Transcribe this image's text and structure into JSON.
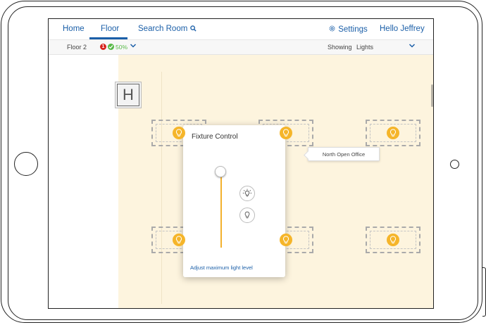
{
  "nav": {
    "home": "Home",
    "floor": "Floor",
    "search_room": "Search Room",
    "settings": "Settings",
    "user": "Hello Jeffrey"
  },
  "subbar": {
    "floor_name": "Floor 2",
    "alert_count": "1",
    "ok_percent": "50%",
    "showing_label": "Showing",
    "showing_value": "Lights"
  },
  "map": {
    "sign_letter": "H",
    "tooltip": "North Open Office"
  },
  "fixture_control": {
    "title": "Fixture Control",
    "adjust_link": "Adjust maximum light level",
    "slider_level": 1.0
  },
  "colors": {
    "accent": "#1b5fa8",
    "bulb": "#f5b52a",
    "plan": "#fdf4de",
    "alert": "#d7241d",
    "ok": "#58b947"
  },
  "icons": [
    "search-icon",
    "gear-icon",
    "chevron-down-icon",
    "lightbulb-icon",
    "bulb-on-icon",
    "bulb-off-icon"
  ]
}
